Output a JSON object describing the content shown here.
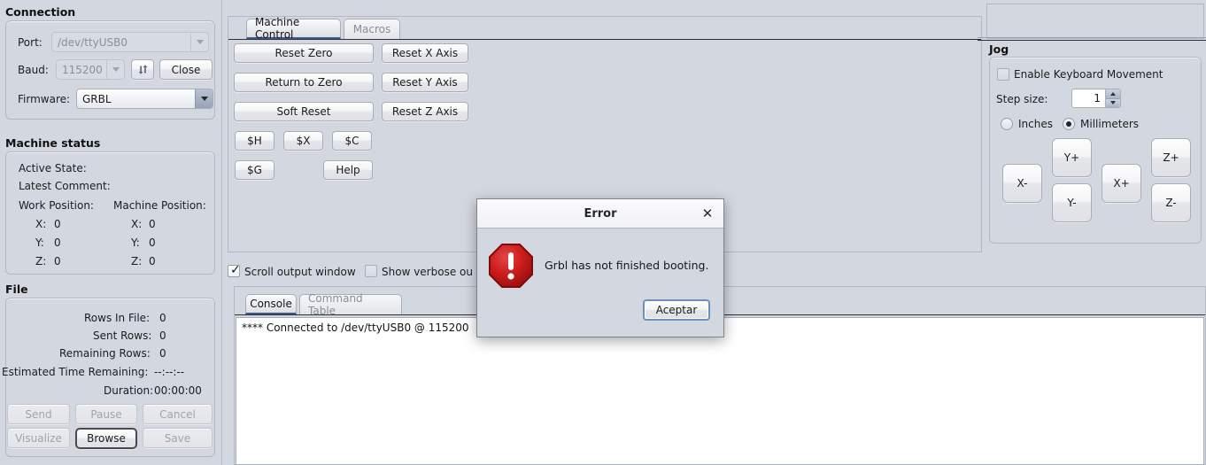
{
  "connection": {
    "title": "Connection",
    "port_label": "Port:",
    "port_value": "/dev/ttyUSB0",
    "baud_label": "Baud:",
    "baud_value": "115200",
    "refresh_icon": "refresh-icon",
    "close_label": "Close",
    "firmware_label": "Firmware:",
    "firmware_value": "GRBL"
  },
  "machine_status": {
    "title": "Machine status",
    "active_state_label": "Active State:",
    "active_state_value": "",
    "latest_comment_label": "Latest Comment:",
    "latest_comment_value": "",
    "work_position_label": "Work Position:",
    "machine_position_label": "Machine Position:",
    "work": [
      {
        "axis": "X:",
        "value": "0"
      },
      {
        "axis": "Y:",
        "value": "0"
      },
      {
        "axis": "Z:",
        "value": "0"
      }
    ],
    "machine": [
      {
        "axis": "X:",
        "value": "0"
      },
      {
        "axis": "Y:",
        "value": "0"
      },
      {
        "axis": "Z:",
        "value": "0"
      }
    ]
  },
  "file": {
    "title": "File",
    "rows": [
      {
        "label": "Rows In File:",
        "value": "0"
      },
      {
        "label": "Sent Rows:",
        "value": "0"
      },
      {
        "label": "Remaining Rows:",
        "value": "0"
      },
      {
        "label": "Estimated Time Remaining:",
        "value": "--:--:--"
      },
      {
        "label": "Duration:",
        "value": "00:00:00"
      }
    ],
    "send_label": "Send",
    "pause_label": "Pause",
    "cancel_label": "Cancel",
    "visualize_label": "Visualize",
    "browse_label": "Browse",
    "save_label": "Save"
  },
  "machine_control": {
    "tabs": [
      {
        "label": "Machine Control",
        "active": true
      },
      {
        "label": "Macros",
        "active": false
      }
    ],
    "reset_zero": "Reset Zero",
    "return_to_zero": "Return to Zero",
    "soft_reset": "Soft Reset",
    "reset_x": "Reset X Axis",
    "reset_y": "Reset Y Axis",
    "reset_z": "Reset Z Axis",
    "cmd_h": "$H",
    "cmd_x": "$X",
    "cmd_c": "$C",
    "cmd_g": "$G",
    "help": "Help"
  },
  "output_options": {
    "scroll_label": "Scroll output window",
    "scroll_checked": true,
    "verbose_label": "Show verbose ou",
    "verbose_checked": false
  },
  "console_panel": {
    "tabs": [
      {
        "label": "Console",
        "active": true
      },
      {
        "label": "Command Table",
        "active": false
      }
    ],
    "lines": [
      "**** Connected to /dev/ttyUSB0 @ 115200"
    ]
  },
  "jog": {
    "title": "Jog",
    "enable_keyboard_label": "Enable Keyboard Movement",
    "enable_keyboard_checked": false,
    "step_size_label": "Step size:",
    "step_size_value": "1",
    "inches_label": "Inches",
    "millimeters_label": "Millimeters",
    "unit_selected": "Millimeters",
    "buttons": {
      "x_minus": "X-",
      "x_plus": "X+",
      "y_plus": "Y+",
      "y_minus": "Y-",
      "z_plus": "Z+",
      "z_minus": "Z-"
    }
  },
  "dialog": {
    "title": "Error",
    "close_icon": "close-icon",
    "icon": "error-stop-icon",
    "message": "Grbl has not finished booting.",
    "ok_label": "Aceptar"
  },
  "colors": {
    "background": "#d3d7df",
    "error_red": "#c41b1b",
    "accent_blue": "#2d4a72"
  }
}
